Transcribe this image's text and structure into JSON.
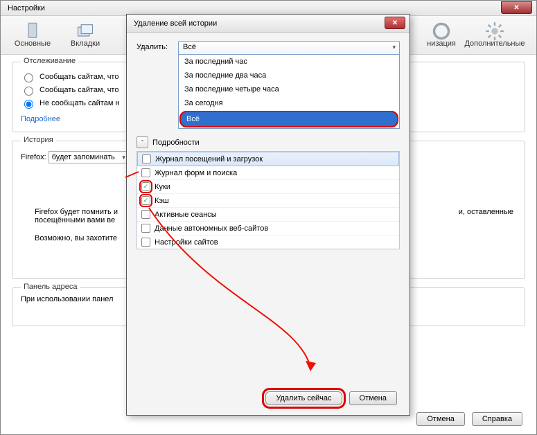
{
  "outer": {
    "title": "Настройки",
    "toolbar": [
      {
        "label": "Основные"
      },
      {
        "label": "Вкладки"
      },
      {
        "label": ""
      },
      {
        "label": ""
      },
      {
        "label": ""
      },
      {
        "label": ""
      },
      {
        "label": ""
      },
      {
        "label": "низация"
      },
      {
        "label": "Дополнительные"
      }
    ],
    "tracking": {
      "legend": "Отслеживание",
      "opt1": "Сообщать сайтам, что",
      "opt2": "Сообщать сайтам, что",
      "opt3": "Не сообщать сайтам н",
      "selected": 2,
      "more": "Подробнее"
    },
    "history": {
      "legend": "История",
      "firefox_label": "Firefox:",
      "combo": "будет запоминать",
      "desc1": "Firefox будет помнить и",
      "desc1b": "и, оставленные",
      "desc2": "посещёнными вами ве",
      "desc3": "Возможно, вы захотите"
    },
    "addressbar": {
      "legend": "Панель адреса",
      "text": "При использовании панел"
    },
    "buttons": {
      "cancel": "Отмена",
      "help": "Справка"
    }
  },
  "dialog": {
    "title": "Удаление всей истории",
    "delete_label": "Удалить:",
    "combo_selected": "Всё",
    "combo_options": [
      "За последний час",
      "За последние два часа",
      "За последние четыре часа",
      "За сегодня",
      "Всё"
    ],
    "details_label": "Подробности",
    "checks": [
      {
        "label": "Журнал посещений и загрузок",
        "checked": false,
        "hl": true
      },
      {
        "label": "Журнал форм и поиска",
        "checked": false
      },
      {
        "label": "Куки",
        "checked": true,
        "ring": true
      },
      {
        "label": "Кэш",
        "checked": true,
        "ring": true
      },
      {
        "label": "Активные сеансы",
        "checked": false
      },
      {
        "label": "Данные автономных веб-сайтов",
        "checked": false
      },
      {
        "label": "Настройки сайтов",
        "checked": false
      }
    ],
    "buttons": {
      "delete_now": "Удалить сейчас",
      "cancel": "Отмена"
    }
  }
}
